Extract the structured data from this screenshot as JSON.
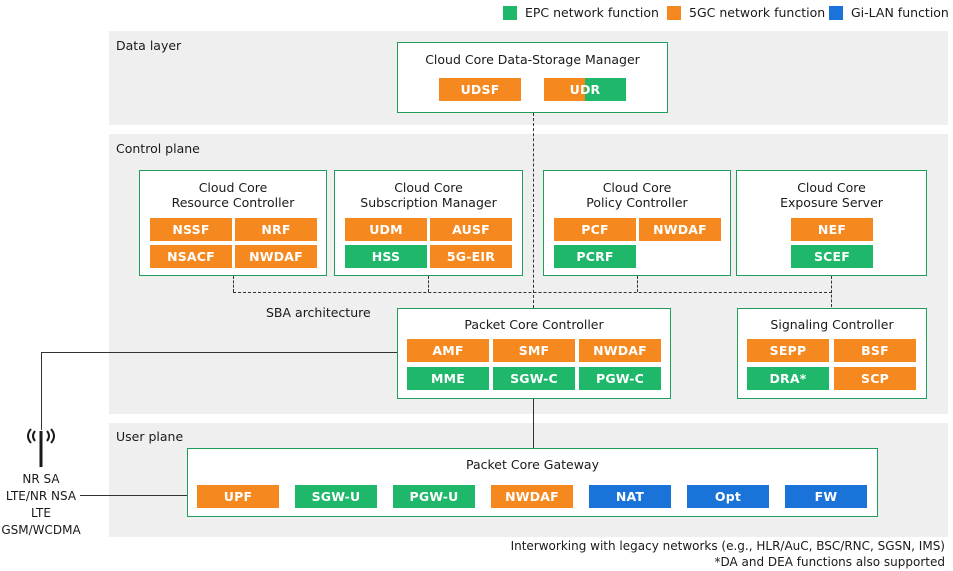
{
  "legend": {
    "epc": {
      "label": "EPC network function",
      "color": "#1fb86a"
    },
    "fivegc": {
      "label": "5GC network function",
      "color": "#f5891f"
    },
    "gilan": {
      "label": "Gi-LAN function",
      "color": "#1a73d9"
    }
  },
  "layers": {
    "data": "Data layer",
    "control": "Control plane",
    "user": "User plane"
  },
  "data_storage": {
    "title": "Cloud Core Data-Storage Manager",
    "udsf": "UDSF",
    "udr": "UDR"
  },
  "resource_controller": {
    "title1": "Cloud Core",
    "title2": "Resource Controller",
    "nssf": "NSSF",
    "nrf": "NRF",
    "nsacf": "NSACF",
    "nwdaf": "NWDAF"
  },
  "subscription_manager": {
    "title1": "Cloud Core",
    "title2": "Subscription Manager",
    "udm": "UDM",
    "ausf": "AUSF",
    "hss": "HSS",
    "eir": "5G-EIR"
  },
  "policy_controller": {
    "title1": "Cloud Core",
    "title2": "Policy Controller",
    "pcf": "PCF",
    "nwdaf": "NWDAF",
    "pcrf": "PCRF"
  },
  "exposure_server": {
    "title1": "Cloud Core",
    "title2": "Exposure Server",
    "nef": "NEF",
    "scef": "SCEF"
  },
  "sba_label": "SBA architecture",
  "packet_core_controller": {
    "title": "Packet Core Controller",
    "amf": "AMF",
    "smf": "SMF",
    "nwdaf": "NWDAF",
    "mme": "MME",
    "sgwc": "SGW-C",
    "pgwc": "PGW-C"
  },
  "signaling_controller": {
    "title": "Signaling Controller",
    "sepp": "SEPP",
    "bsf": "BSF",
    "dra": "DRA*",
    "scp": "SCP"
  },
  "packet_core_gateway": {
    "title": "Packet Core Gateway",
    "upf": "UPF",
    "sgwu": "SGW-U",
    "pgwu": "PGW-U",
    "nwdaf": "NWDAF",
    "nat": "NAT",
    "opt": "Opt",
    "fw": "FW"
  },
  "radio": {
    "line1": "NR SA",
    "line2": "LTE/NR NSA",
    "line3": "LTE",
    "line4": "GSM/WCDMA"
  },
  "footer": {
    "line1": "Interworking with legacy networks (e.g., HLR/AuC, BSC/RNC, SGSN, IMS)",
    "line2": "*DA and DEA functions also supported"
  }
}
